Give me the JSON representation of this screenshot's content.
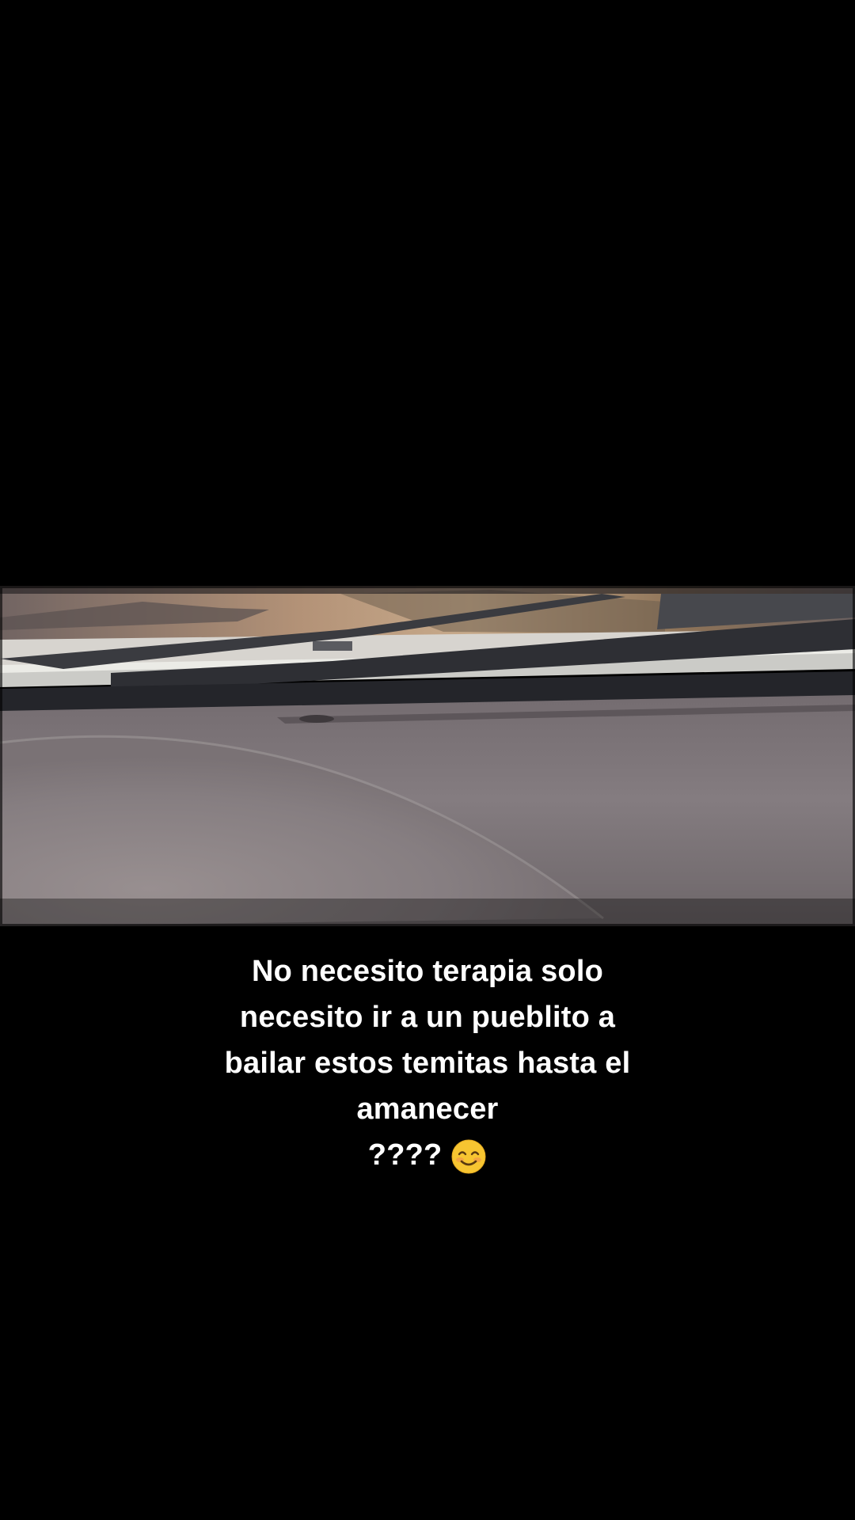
{
  "video": {
    "scene": "dashboard-and-wiper-view",
    "colors": {
      "dirt": "#a68a72",
      "dashboard": "#847c80",
      "wiper": "#3a3b40",
      "hood": "#d7d4cf"
    }
  },
  "caption": {
    "lines": [
      "No necesito terapia solo",
      "necesito ir a un pueblito a",
      "bailar estos temitas hasta el",
      "amanecer"
    ],
    "emoji_prefix": "????",
    "emoji_icon": "smiling-face-icon"
  }
}
